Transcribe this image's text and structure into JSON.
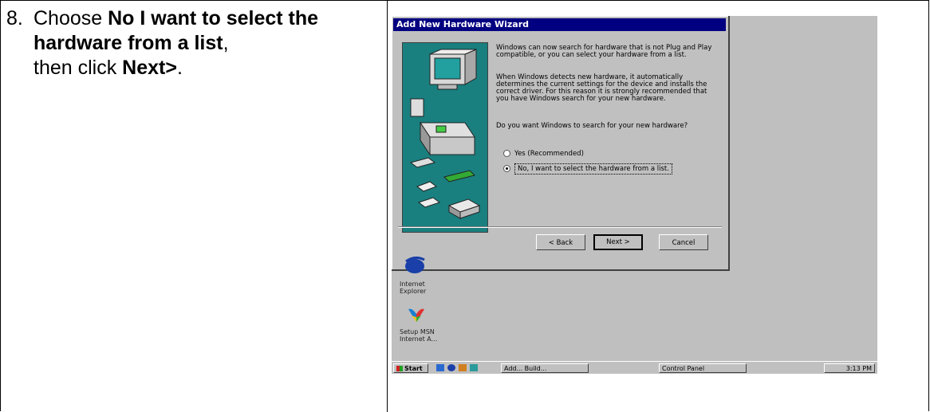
{
  "instruction": {
    "number": "8.",
    "choose": "Choose",
    "option_bold": "No I want to select the hardware from a list",
    "comma": ",",
    "then_click": "then click",
    "next_bold": "Next>",
    "period": "."
  },
  "wizard": {
    "title": "Add New Hardware Wizard",
    "para1": "Windows can now search for hardware that is not Plug and Play compatible, or you can select your hardware from a list.",
    "para2": "When Windows detects new hardware, it automatically determines the current settings for the device and installs the correct driver. For this reason it is strongly recommended that you have Windows search for your new hardware.",
    "question": "Do you want Windows to search for your new hardware?",
    "option_yes": "Yes (Recommended)",
    "option_no": "No, I want to select the hardware from a list.",
    "back_label": "< Back",
    "next_label": "Next >",
    "cancel_label": "Cancel"
  },
  "desktop": {
    "icon1_label": "Internet Explorer",
    "icon2_label": "Setup MSN Internet A..."
  },
  "taskbar": {
    "start_label": "Start",
    "task1": "Add... Build...",
    "task2": "Control Panel",
    "clock": "3:13 PM"
  }
}
